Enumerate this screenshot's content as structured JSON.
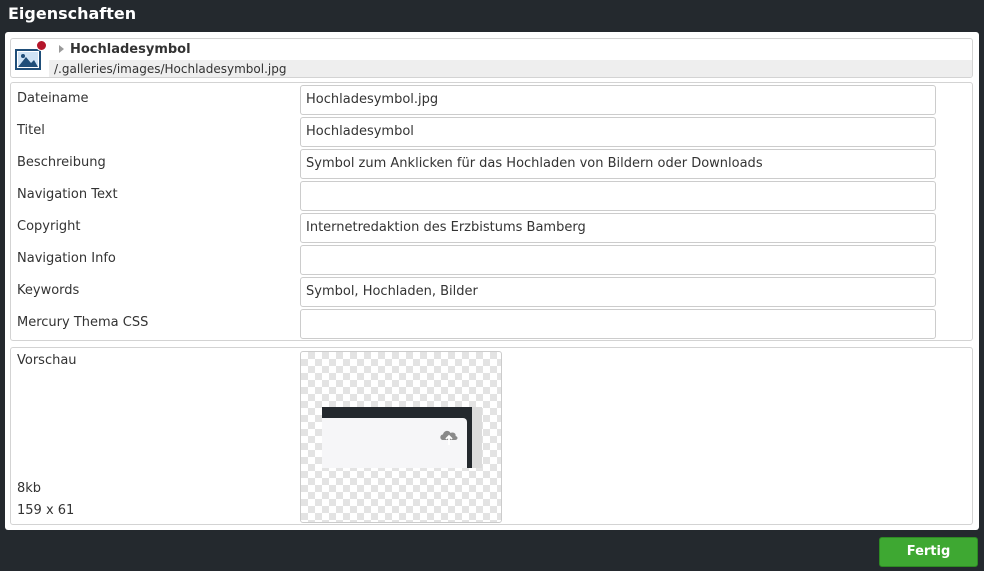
{
  "dialog": {
    "title": "Eigenschaften"
  },
  "resource": {
    "name": "Hochladesymbol",
    "path": "/.galleries/images/Hochladesymbol.jpg",
    "icon": "image-icon",
    "badge_color": "#b5162b"
  },
  "properties": [
    {
      "label": "Dateiname",
      "value": "Hochladesymbol.jpg"
    },
    {
      "label": "Titel",
      "value": "Hochladesymbol"
    },
    {
      "label": "Beschreibung",
      "value": "Symbol zum Anklicken für das Hochladen von Bildern oder Downloads"
    },
    {
      "label": "Navigation Text",
      "value": ""
    },
    {
      "label": "Copyright",
      "value": "Internetredaktion des Erzbistums Bamberg"
    },
    {
      "label": "Navigation Info",
      "value": ""
    },
    {
      "label": "Keywords",
      "value": "Symbol, Hochladen, Bilder"
    },
    {
      "label": "Mercury Thema CSS",
      "value": ""
    }
  ],
  "preview": {
    "label": "Vorschau",
    "size": "8kb",
    "dimensions": "159 x 61",
    "icon": "cloud-upload-icon"
  },
  "footer": {
    "done_label": "Fertig",
    "accent_color": "#3ea832"
  }
}
